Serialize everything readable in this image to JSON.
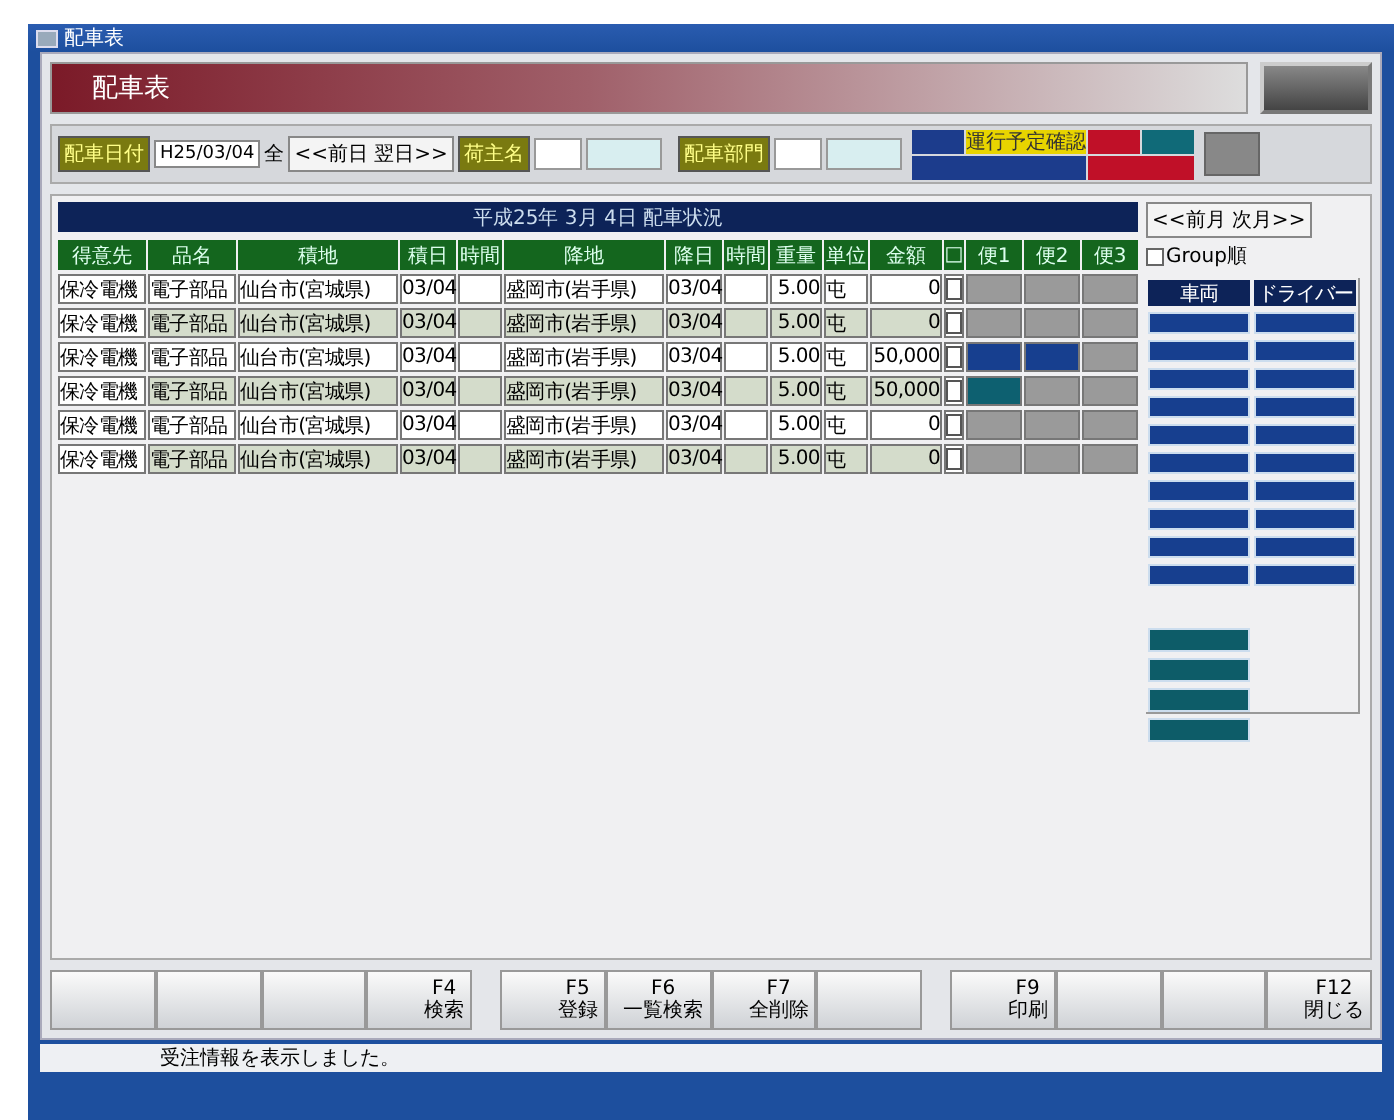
{
  "window": {
    "title": "配車表"
  },
  "header": {
    "title": "配車表"
  },
  "filters": {
    "date_label": "配車日付",
    "date_value": "H25/03/04",
    "all": "全",
    "day_nav": "<<前日 翌日>>",
    "shipper_label": "荷主名",
    "dept_label": "配車部門"
  },
  "legend": [
    {
      "color": "#1c3c8c"
    },
    {
      "color": "#e8d400",
      "label": "運行予定確認"
    },
    {
      "color": "#c01028"
    },
    {
      "color": "#106a78"
    },
    {
      "color": "#1c3c8c"
    },
    {
      "color": "#c01028"
    }
  ],
  "board": {
    "title": "平成25年 3月 4日 配車状況",
    "columns": [
      {
        "label": "得意先"
      },
      {
        "label": "品名"
      },
      {
        "label": "積地"
      },
      {
        "label": "積日"
      },
      {
        "label": "時間"
      },
      {
        "label": "降地"
      },
      {
        "label": "降日"
      },
      {
        "label": "時間"
      },
      {
        "label": "重量"
      },
      {
        "label": "単位"
      },
      {
        "label": "金額"
      },
      {
        "label": "□"
      },
      {
        "label": "便1"
      },
      {
        "label": "便2"
      },
      {
        "label": "便3"
      }
    ],
    "rows": [
      {
        "customer": "保冷電機",
        "item": "電子部品",
        "from": "仙台市(宮城県)",
        "load_date": "03/04",
        "to": "盛岡市(岩手県)",
        "unload_date": "03/04",
        "weight": "5.00",
        "unit": "屯",
        "amount": "0",
        "checked": false,
        "trips": [
          {
            "kind": "empty"
          },
          {
            "kind": "empty"
          },
          {
            "kind": "empty"
          }
        ]
      },
      {
        "customer": "保冷電機",
        "item": "電子部品",
        "from": "仙台市(宮城県)",
        "load_date": "03/04",
        "to": "盛岡市(岩手県)",
        "unload_date": "03/04",
        "weight": "5.00",
        "unit": "屯",
        "amount": "0",
        "checked": false,
        "trips": [
          {
            "kind": "empty"
          },
          {
            "kind": "empty"
          },
          {
            "kind": "empty"
          }
        ]
      },
      {
        "customer": "保冷電機",
        "item": "電子部品",
        "from": "仙台市(宮城県)",
        "load_date": "03/04",
        "to": "盛岡市(岩手県)",
        "unload_date": "03/04",
        "weight": "5.00",
        "unit": "屯",
        "amount": "50,000",
        "checked": false,
        "trips": [
          {
            "kind": "assigned"
          },
          {
            "kind": "assigned"
          },
          {
            "kind": "empty"
          }
        ]
      },
      {
        "customer": "保冷電機",
        "item": "電子部品",
        "from": "仙台市(宮城県)",
        "load_date": "03/04",
        "to": "盛岡市(岩手県)",
        "unload_date": "03/04",
        "weight": "5.00",
        "unit": "屯",
        "amount": "50,000",
        "checked": false,
        "trips": [
          {
            "kind": "confirmed"
          },
          {
            "kind": "empty"
          },
          {
            "kind": "empty"
          }
        ]
      },
      {
        "customer": "保冷電機",
        "item": "電子部品",
        "from": "仙台市(宮城県)",
        "load_date": "03/04",
        "to": "盛岡市(岩手県)",
        "unload_date": "03/04",
        "weight": "5.00",
        "unit": "屯",
        "amount": "0",
        "checked": false,
        "trips": [
          {
            "kind": "empty"
          },
          {
            "kind": "empty"
          },
          {
            "kind": "empty"
          }
        ]
      },
      {
        "customer": "保冷電機",
        "item": "電子部品",
        "from": "仙台市(宮城県)",
        "load_date": "03/04",
        "to": "盛岡市(岩手県)",
        "unload_date": "03/04",
        "weight": "5.00",
        "unit": "屯",
        "amount": "0",
        "checked": false,
        "trips": [
          {
            "kind": "empty"
          },
          {
            "kind": "empty"
          },
          {
            "kind": "empty"
          }
        ]
      }
    ]
  },
  "side": {
    "month_nav": "<<前月 次月>>",
    "group_order": {
      "label": "Group順",
      "checked": false
    },
    "headers": [
      "車両",
      "ドライバー"
    ],
    "vehicles": [
      {
        "kind": "pair"
      },
      {
        "kind": "pair"
      },
      {
        "kind": "pair"
      },
      {
        "kind": "pair"
      },
      {
        "kind": "pair"
      },
      {
        "kind": "pair"
      },
      {
        "kind": "pair"
      },
      {
        "kind": "pair"
      },
      {
        "kind": "pair"
      },
      {
        "kind": "pair"
      },
      {
        "kind": "spare"
      },
      {
        "kind": "spare"
      },
      {
        "kind": "spare"
      },
      {
        "kind": "spare"
      }
    ]
  },
  "function_keys": [
    {
      "kind": "blank"
    },
    {
      "kind": "blank"
    },
    {
      "kind": "blank"
    },
    {
      "kind": "key",
      "key": "F4",
      "label": "検索"
    },
    {
      "kind": "key",
      "key": "F5",
      "label": "登録"
    },
    {
      "kind": "key",
      "key": "F6",
      "label": "一覧検索"
    },
    {
      "kind": "key",
      "key": "F7",
      "label": "全削除"
    },
    {
      "kind": "blank"
    },
    {
      "kind": "key",
      "key": "F9",
      "label": "印刷"
    },
    {
      "kind": "blank"
    },
    {
      "kind": "blank"
    },
    {
      "kind": "key",
      "key": "F12",
      "label": "閉じる"
    }
  ],
  "status_bar": {
    "message": "受注情報を表示しました。"
  }
}
